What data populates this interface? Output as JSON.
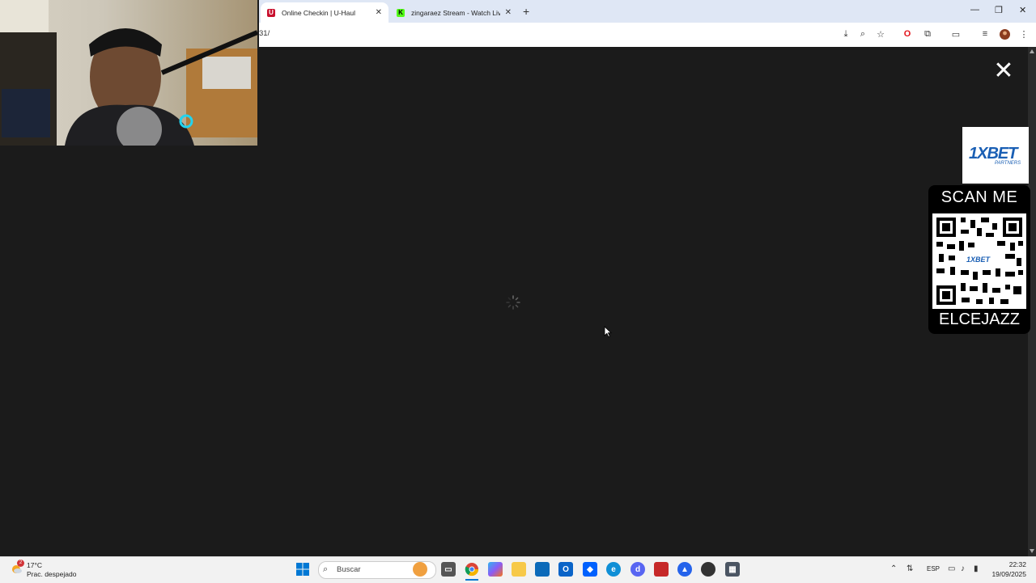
{
  "browser": {
    "tabs": [
      {
        "title": "Online Checkin | U-Haul",
        "favicon": "uhaul-icon",
        "active": true
      },
      {
        "title": "zingaraez Stream - Watch Live",
        "favicon": "kick-icon",
        "active": false
      }
    ],
    "url": "31/",
    "new_tab": "+",
    "window_controls": {
      "minimize": "—",
      "restore": "❐",
      "close": "✕"
    }
  },
  "content": {
    "close_symbol": "✕",
    "state": "loading"
  },
  "ad": {
    "brand": "1XBET",
    "sub": "PARTNERS",
    "scan_label": "SCAN ME",
    "code": "ELCEJAZZ",
    "qr_brand": "1XBET"
  },
  "taskbar": {
    "weather": {
      "badge": "2",
      "temp": "17°C",
      "desc": "Prac. despejado"
    },
    "search_placeholder": "Buscar",
    "language": "ESP",
    "clock": {
      "time": "22:32",
      "date": "19/09/2025"
    }
  },
  "colors": {
    "page_bg": "#1b1b1b",
    "tabbar_bg": "#dfe7f5",
    "ad_blue": "#1a5fb4",
    "taskbar_bg": "#f2f2f2"
  }
}
